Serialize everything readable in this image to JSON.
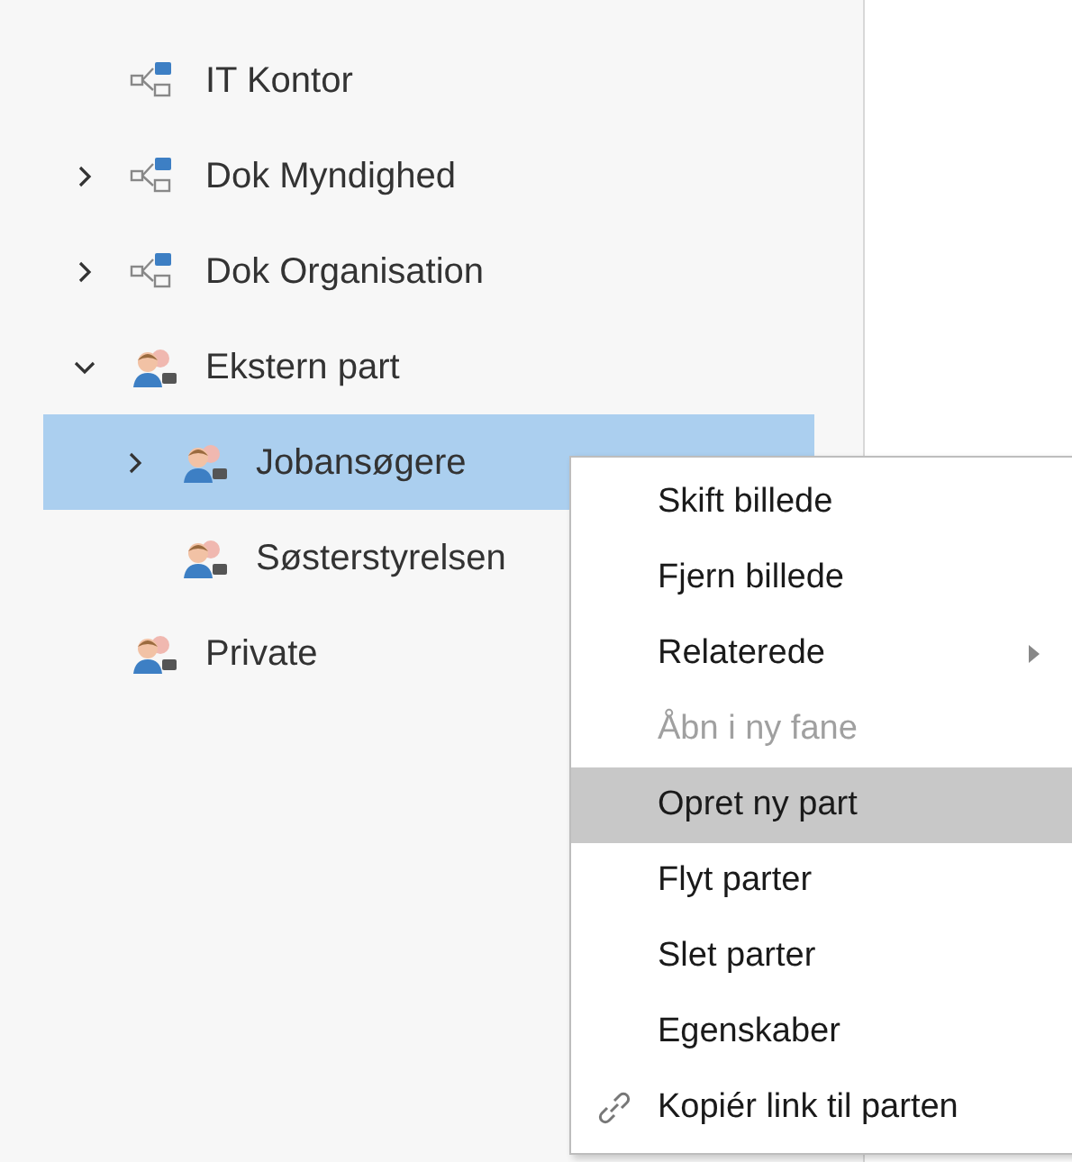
{
  "tree": [
    {
      "label": "IT Kontor",
      "kind": "unit",
      "expandable": false,
      "expanded": false,
      "selected": false
    },
    {
      "label": "Dok Myndighed",
      "kind": "unit",
      "expandable": true,
      "expanded": false,
      "selected": false
    },
    {
      "label": "Dok Organisation",
      "kind": "unit",
      "expandable": true,
      "expanded": false,
      "selected": false
    },
    {
      "label": "Ekstern part",
      "kind": "group",
      "expandable": true,
      "expanded": true,
      "selected": false,
      "children": [
        {
          "label": "Jobansøgere",
          "kind": "group",
          "expandable": true,
          "expanded": false,
          "selected": true
        },
        {
          "label": "Søsterstyrelsen",
          "kind": "group",
          "expandable": false,
          "expanded": false,
          "selected": false
        }
      ]
    },
    {
      "label": "Private",
      "kind": "group",
      "expandable": false,
      "expanded": false,
      "selected": false
    }
  ],
  "context_menu": [
    {
      "label": "Skift billede",
      "kind": "plain",
      "disabled": false,
      "selected": false
    },
    {
      "label": "Fjern billede",
      "kind": "plain",
      "disabled": false,
      "selected": false
    },
    {
      "label": "Relaterede",
      "kind": "submenu",
      "disabled": false,
      "selected": false
    },
    {
      "label": "Åbn i ny fane",
      "kind": "plain",
      "disabled": true,
      "selected": false
    },
    {
      "label": "Opret ny part",
      "kind": "plain",
      "disabled": false,
      "selected": true
    },
    {
      "label": "Flyt parter",
      "kind": "plain",
      "disabled": false,
      "selected": false
    },
    {
      "label": "Slet parter",
      "kind": "plain",
      "disabled": false,
      "selected": false
    },
    {
      "label": "Egenskaber",
      "kind": "plain",
      "disabled": false,
      "selected": false
    },
    {
      "label": "Kopiér link til parten",
      "kind": "link",
      "disabled": false,
      "selected": false
    }
  ]
}
